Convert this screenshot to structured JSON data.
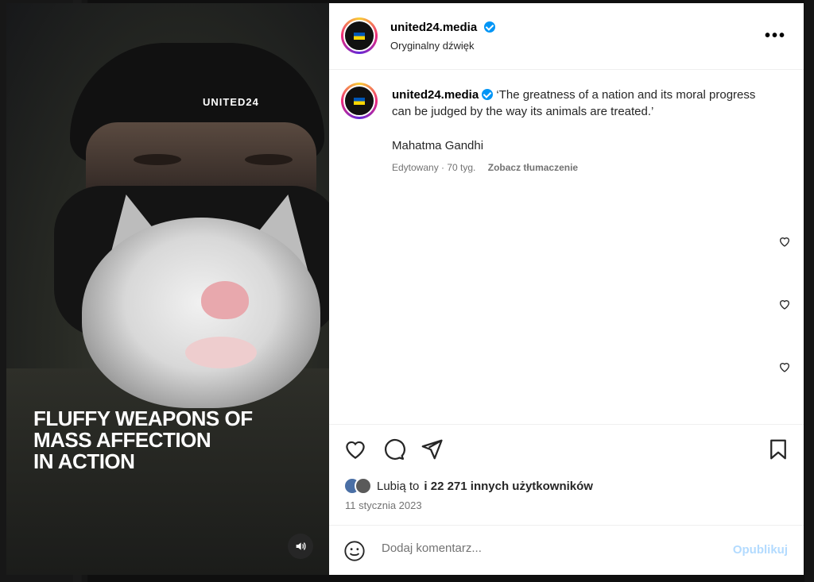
{
  "media": {
    "brand": "UNITED24",
    "caption_lines": [
      "FLUFFY WEAPONS OF",
      "MASS AFFECTION",
      "IN ACTION"
    ],
    "sound_icon": "speaker-icon"
  },
  "post": {
    "username": "united24.media",
    "audio": "Oryginalny dźwięk",
    "caption": "‘The greatness of a nation and its moral progress can be judged by the way its animals are treated.’",
    "author_line": "Mahatma Gandhi",
    "edited": "Edytowany · 70 tyg.",
    "translate": "Zobacz tłumaczenie",
    "likes_prefix": "Lubią to",
    "likes_suffix": "i 22 271 innych użytkowników",
    "date": "11 stycznia 2023"
  },
  "composer": {
    "placeholder": "Dodaj komentarz...",
    "publish": "Opublikuj"
  },
  "colors": {
    "verified": "#0095f6",
    "publish_disabled": "#b3dbff"
  }
}
